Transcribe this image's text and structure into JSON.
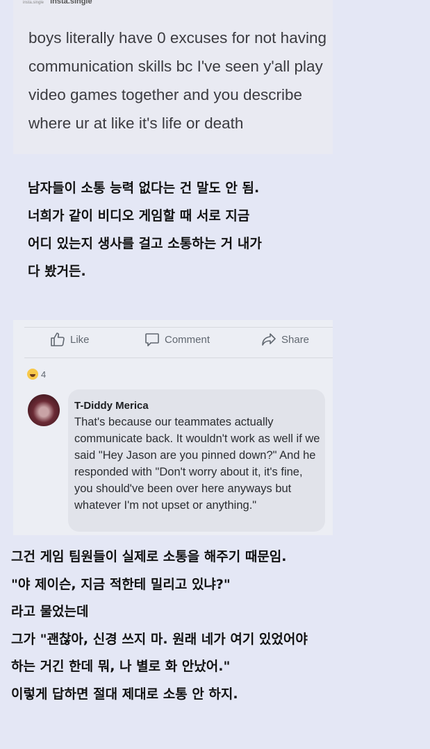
{
  "post": {
    "small_label": "insta.single",
    "username": "insta.single",
    "text": "boys literally have 0 excuses for not having communication skills bc I've seen y'all play video games together and you describe where ur at like it's life or death"
  },
  "translation1": "남자들이 소통 능력 없다는 건 말도 안 됨.\n너희가 같이 비디오 게임할 때 서로 지금\n어디 있는지 생사를 걸고 소통하는 거 내가\n다 봤거든.",
  "facebook": {
    "like_label": "Like",
    "comment_label": "Comment",
    "share_label": "Share",
    "reaction_count": "4",
    "commenter_name": "T-Diddy Merica",
    "comment_text": "That's because our teammates actually communicate back. It wouldn't work as well if we said \"Hey Jason are you pinned down?\" And he responded with \"Don't worry about it, it's fine, you should've been over here anyways but whatever I'm not upset or anything.\""
  },
  "translation2": "그건 게임 팀원들이 실제로 소통을 해주기 때문임.\n\"야 제이슨, 지금 적한테 밀리고 있냐?\"\n라고 물었는데\n그가 \"괜찮아, 신경 쓰지 마. 원래 네가 여기 있었어야\n하는 거긴 한데 뭐, 나 별로 화 안났어.\"\n이렇게 답하면 절대 제대로 소통 안 하지.",
  "colors": {
    "page_background": "#e4e7f5",
    "post_background": "#e9eaf2",
    "facebook_gray": "#606770"
  }
}
